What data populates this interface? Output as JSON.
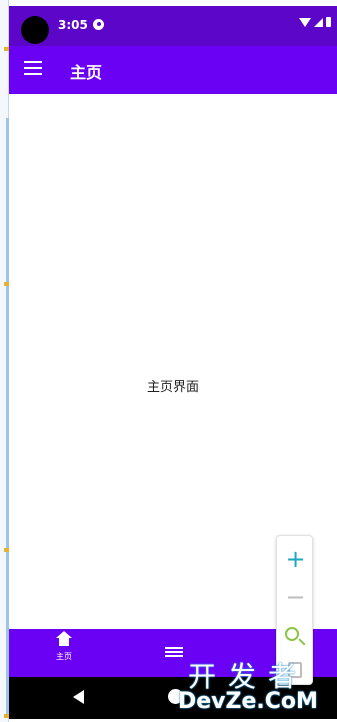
{
  "status_bar": {
    "time": "3:05"
  },
  "app_bar": {
    "title": "主页"
  },
  "main": {
    "content_text": "主页界面"
  },
  "bottom_nav": {
    "items": [
      {
        "label": "主页",
        "icon": "home-icon"
      },
      {
        "label": "",
        "icon": "list-icon"
      }
    ]
  },
  "zoom_controls": {
    "zoom_in": "+",
    "zoom_out": "−"
  },
  "watermark": {
    "cn": "开发者",
    "en": "DevZe.CoM"
  },
  "colors": {
    "status_bar": "#5c06c9",
    "app_bar": "#6a00f4",
    "zoom_in": "#1fa6c4",
    "zoom_reset": "#8bc34a"
  }
}
